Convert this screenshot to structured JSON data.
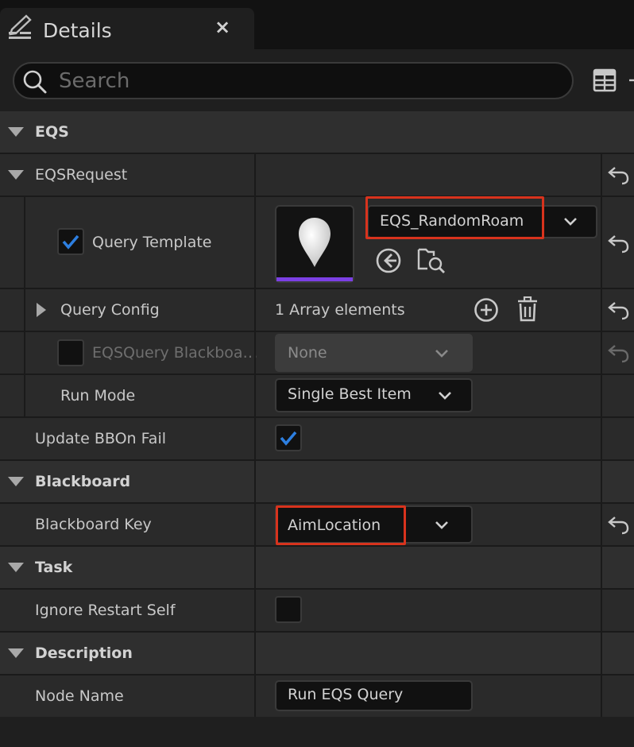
{
  "panel": {
    "title": "Details",
    "close_label": "×"
  },
  "search": {
    "placeholder": "Search",
    "value": ""
  },
  "sections": {
    "eqs": "EQS",
    "blackboard": "Blackboard",
    "task": "Task",
    "description": "Description"
  },
  "eqs_request": {
    "label": "EQSRequest",
    "query_template": {
      "label": "Query Template",
      "checked": true,
      "value": "EQS_RandomRoam"
    },
    "query_config": {
      "label": "Query Config",
      "value": "1 Array elements"
    },
    "blackboard_asset": {
      "label": "EQSQuery Blackboa…",
      "checked": false,
      "value": "None"
    },
    "run_mode": {
      "label": "Run Mode",
      "value": "Single Best Item"
    }
  },
  "update_bb_on_fail": {
    "label": "Update BBOn Fail",
    "checked": true
  },
  "blackboard_key": {
    "label": "Blackboard Key",
    "value": "AimLocation"
  },
  "ignore_restart_self": {
    "label": "Ignore Restart Self",
    "checked": false
  },
  "node_name": {
    "label": "Node Name",
    "value": "Run EQS Query"
  },
  "colors": {
    "checkmark": "#2d7fe0",
    "highlight": "#d8331d",
    "thumbnail_bar": "#7b3fe4"
  },
  "icons": [
    "details-icon",
    "close-icon",
    "search-icon",
    "table-view-icon",
    "reset-arrow-icon",
    "chevron-down-icon",
    "browse-arrow-icon",
    "find-in-browser-icon",
    "add-element-icon",
    "delete-icon",
    "checkmark-icon",
    "map-pin-icon"
  ]
}
